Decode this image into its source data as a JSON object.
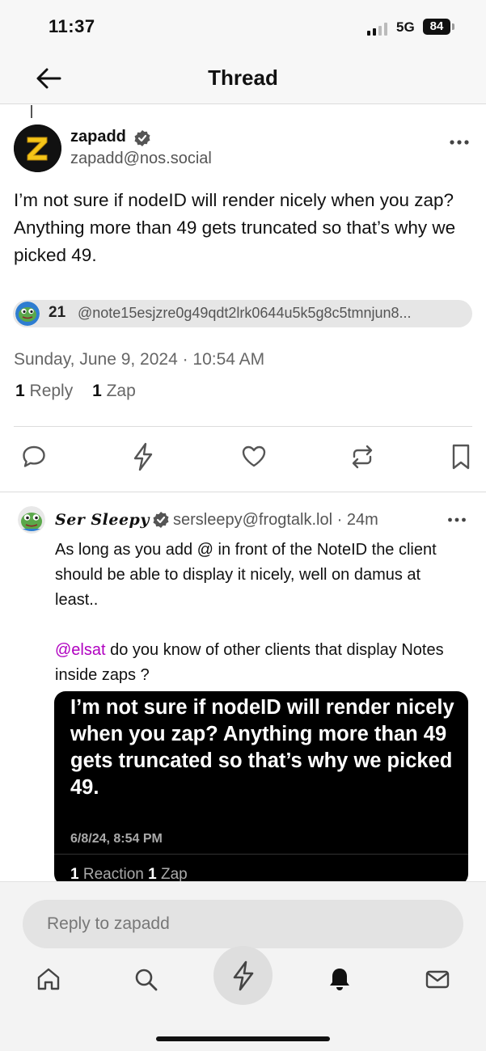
{
  "status_bar": {
    "time": "11:37",
    "network": "5G",
    "battery": "84"
  },
  "header": {
    "title": "Thread",
    "back_icon": "arrow-left-icon"
  },
  "post": {
    "author_name": "zapadd",
    "author_handle": "zapadd@nos.social",
    "avatar_letter": "Z",
    "body": "I’m not sure if nodeID will render nicely when you zap? Anything more than 49 gets truncated so that’s why we picked 49.",
    "zap": {
      "amount": "21",
      "note": "@note15esjzre0g49qdt2lrk0644u5k5g8c5tmnjun8..."
    },
    "date": "Sunday, June 9, 2024 · 10:54 AM",
    "replies_count": "1",
    "replies_label": "Reply",
    "zaps_count": "1",
    "zaps_label": "Zap",
    "actions": [
      "reply-icon",
      "zap-icon",
      "like-icon",
      "repost-icon",
      "bookmark-icon"
    ]
  },
  "reply": {
    "author_name": "Ser Sleepy",
    "author_handle": "sersleepy@frogtalk.lol · 24m",
    "text_1": "As long as you add @ in front of the NoteID the client should be able to display it nicely, well on damus at least..",
    "mention": "@elsat",
    "text_2": " do you know of other clients that display Notes inside zaps ?",
    "quote": {
      "text": "I’m not sure if nodeID will render nicely when you zap? Anything more than 49 gets truncated so that’s why we picked 49.",
      "date": "6/8/24, 8:54 PM",
      "reactions_count": "1",
      "reactions_label": "Reaction",
      "zaps_count": "1",
      "zaps_label": "Zap"
    }
  },
  "composer": {
    "placeholder": "Reply to zapadd"
  },
  "tab_bar": [
    "home-icon",
    "search-icon",
    "zap-icon",
    "bell-icon",
    "mail-icon"
  ]
}
